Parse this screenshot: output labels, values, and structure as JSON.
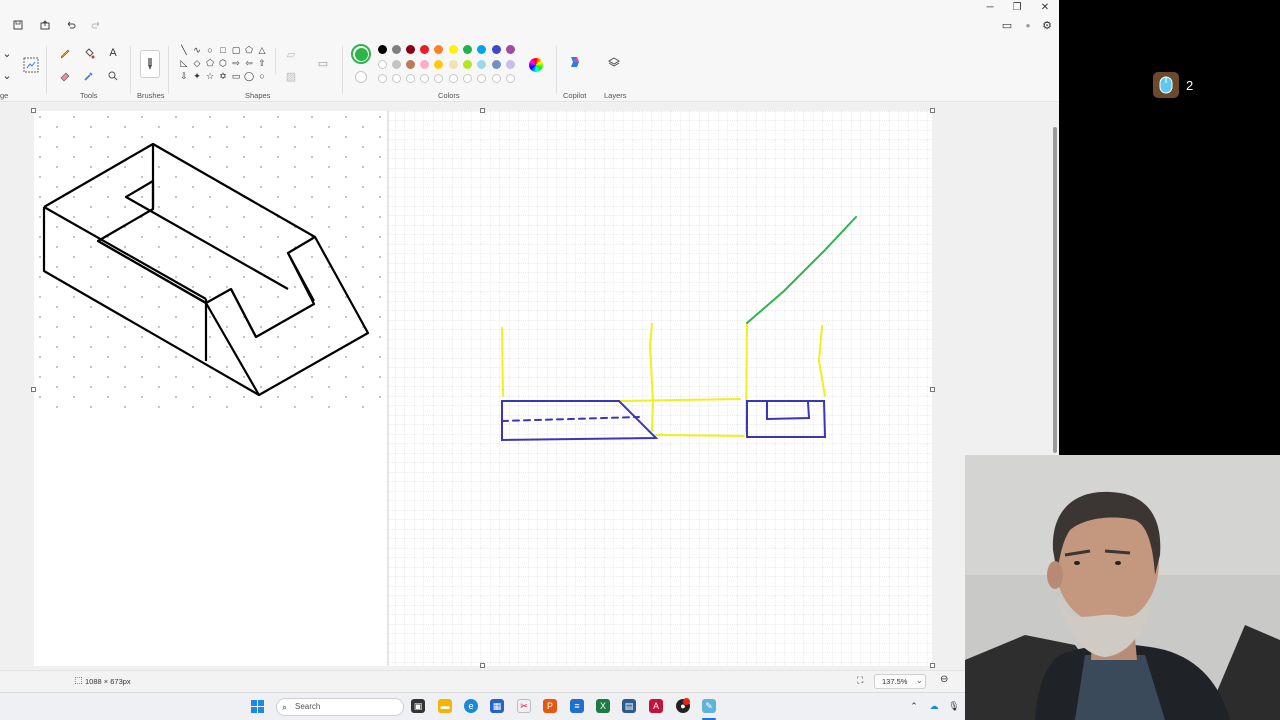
{
  "ribbon": {
    "groups": {
      "image": "ge",
      "tools": "Tools",
      "brushes": "Brushes",
      "shapes": "Shapes",
      "colors": "Colors",
      "copilot": "Copilot",
      "layers": "Layers"
    },
    "active_color": "#2db44b",
    "palette_row1": [
      "#000000",
      "#7f7f7f",
      "#880015",
      "#ed1c24",
      "#ff7f27",
      "#fff200",
      "#22b14c",
      "#00a2e8",
      "#3f48cc",
      "#a349a4"
    ],
    "palette_row2": [
      "#ffffff",
      "#c3c3c3",
      "#b97a57",
      "#ffaec9",
      "#ffc90e",
      "#efe4b0",
      "#b5e61d",
      "#99d9ea",
      "#7092be",
      "#c8bfe7"
    ]
  },
  "status": {
    "canvas_size": "1088 × 673px",
    "zoom": "137.5%"
  },
  "taskbar": {
    "search_placeholder": "Search"
  },
  "overlay": {
    "click_count": "2"
  }
}
